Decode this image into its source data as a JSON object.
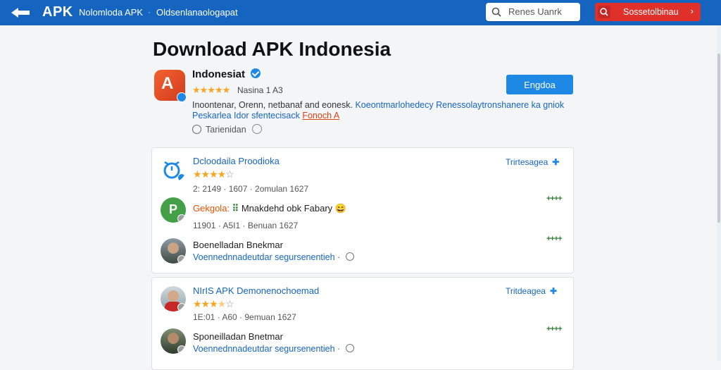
{
  "header": {
    "brand": "APK",
    "brand_sub": "Nolomloda APK",
    "nav_dot": "·",
    "nav_link": "Oldsenlanaologapat",
    "search_placeholder": "Renes Uanrk",
    "cta_label": "Sossetolbinau",
    "cta_arrow": "›"
  },
  "page": {
    "title": "Download APK Indonesia"
  },
  "hero": {
    "icon_glyph": "A",
    "name": "Indonesiat",
    "stars": "★★★★★",
    "meta": "Nasina 1 A3",
    "button": "Engdoa",
    "desc_part1": "Inoontenar, Orenn, netbanaf and eonesk.",
    "desc_part2": "Koeontmarlohedecy Renessolaytronshanere ka gniok",
    "desc2_blue": "Peskarlea Idor sfentecisack",
    "desc2_red": "Fonoch A",
    "time": "Tarienidan"
  },
  "entries": [
    {
      "title": "Dcloodaila Proodioka",
      "stars": "★★★★",
      "stars_empty": "☆",
      "meta": "2: 2149 · 1607 · 2omulan 1627",
      "follow": "Trirtesagea",
      "arrow": "✚"
    },
    {
      "title_orange": "Gekgola:",
      "title_green": "⠿",
      "title_dark": "Mnakdehd obk Fabary",
      "emoji": "😄",
      "meta": "11901 · A5I1 · Benuan 1627",
      "plus": "++++"
    },
    {
      "title": "Boenelladan Bnekmar",
      "sub": "Voennednnadeutdar segursenentieh",
      "plus": "++++"
    }
  ],
  "entries2": [
    {
      "title": "NIrIS APK Demonenochoemad",
      "stars": "★★★",
      "stars_half": "★",
      "stars_empty": "☆",
      "meta": "1E:01 · A60 · 9emuan 1627",
      "follow": "Tritdeagea",
      "arrow": "✚"
    },
    {
      "title": "Sponeilladan Bnetmar",
      "sub": "Voennednnadeutdar segursenentieh",
      "plus": "++++"
    }
  ],
  "colors": {
    "topbar": "#1565c0",
    "cta": "#e0302a",
    "accent": "#1e88e5",
    "star": "#f5a623"
  }
}
